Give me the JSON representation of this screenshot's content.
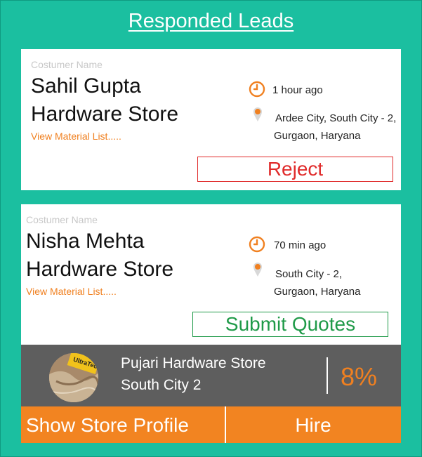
{
  "page": {
    "title": "Responded Leads"
  },
  "leads": [
    {
      "customer_label": "Costumer Name",
      "name": "Sahil Gupta",
      "store": "Hardware Store",
      "material_link": "View Material List.....",
      "time": "1 hour ago",
      "address_line1": "Ardee City, South City - 2,",
      "address_line2": "Gurgaon, Haryana",
      "action_label": "Reject"
    },
    {
      "customer_label": "Costumer Name",
      "name": "Nisha Mehta",
      "store": "Hardware Store",
      "material_link": "View Material List.....",
      "time": "70 min ago",
      "address_line1": "South City - 2,",
      "address_line2": "Gurgaon, Haryana",
      "action_label": "Submit Quotes"
    }
  ],
  "store_bar": {
    "store_name": "Pujari Hardware Store",
    "store_city": "South City 2",
    "percent": "8%",
    "avatar_brand_text": "UltraTech"
  },
  "actions": {
    "show_profile": "Show Store Profile",
    "hire": "Hire"
  },
  "colors": {
    "background": "#1bbfa0",
    "accent_orange": "#f28421",
    "reject_red": "#e02a2a",
    "submit_green": "#1f9a48",
    "store_bar_gray": "#5e5e5e"
  }
}
